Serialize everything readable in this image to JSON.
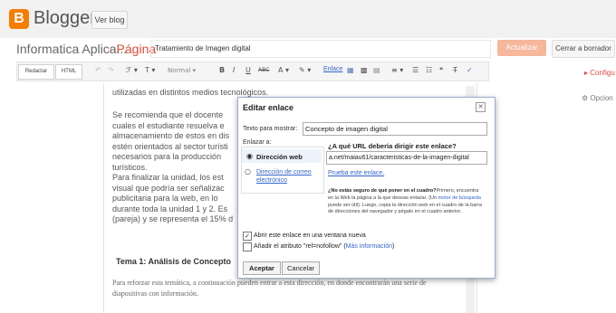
{
  "app": {
    "name": "Blogger",
    "view_blog": "Ver blog",
    "logo_letter": "B"
  },
  "post": {
    "blog_name": "Informatica Aplica...",
    "separator": "· Página",
    "title_value": "Tratamiento de Imagen digital",
    "publish": "Actualizar",
    "close": "Cerrar a borrador"
  },
  "toolbar": {
    "compose": "Redactar",
    "html": "HTML",
    "undo_icon": "↶",
    "redo_icon": "↷",
    "font_icon": "ℱ ▾",
    "size_icon": "T ▾",
    "format": "Normal ▾",
    "bold": "B",
    "italic": "I",
    "underline": "U",
    "strike": "ABC",
    "text_color": "A ▾",
    "highlight": "✎ ▾",
    "link": "Enlace",
    "image_icon": "▦",
    "video_icon": "▩",
    "jump_icon": "▤",
    "align_icon": "≡ ▾",
    "numlist_icon": "☰",
    "bullist_icon": "☷",
    "quote_icon": "❝",
    "clear_icon": "T̶",
    "spell_icon": "✓"
  },
  "sidebar": {
    "config": "▸ Configu",
    "options": "⚙ Opcion"
  },
  "editor": {
    "lines": [
      "utilizadas en distintos medios tecnológicos.",
      "",
      "Se recomienda que el docente",
      "cuales el estudiante resuelva e",
      "almacenamiento de estos en dis",
      "estén orientados al sector turísti",
      "necesarios para la producción",
      "turísticos.",
      "Para finalizar la unidad, los est",
      "visual que podría ser señalizac",
      "publicitaria para la web, en lo",
      "durante toda la unidad 1 y 2. Es",
      "(pareja) y se representa el 15% d"
    ],
    "heading": "Tema 1: Análisis de Concepto",
    "serif_text": "Para reforzar esta temática, a continuación pueden entrar a esta dirección, en donde encontrarán una serie de diapositivas con información."
  },
  "dialog": {
    "title": "Editar enlace",
    "close_icon": "✕",
    "text_label": "Texto para mostrar:",
    "text_value": "Concepto de imagen digital",
    "link_to": "Enlazar a:",
    "web_option": "Dirección web",
    "email_option": "Dirección de correo electrónico",
    "radio_on": "◉",
    "radio_off": "○",
    "url_question": "¿A qué URL debería dirigir este enlace?",
    "url_value": "a.net/maiau61/caracteristicas-de-la-imagen-digital",
    "test_link": "Prueba este enlace.",
    "help_bold": "¿No estás seguro de qué poner en el cuadro?",
    "help_1": "Primero, encuentra en la Web la página a la que deseas enlazar. (Un ",
    "help_link": "motor de búsqueda",
    "help_2": " puede ser útil). Luego, copia la dirección web en el cuadro de la barra de direcciones del navegador y pégalo en el cuadro anterior.",
    "new_window": "Abrir este enlace en una ventana nueva",
    "nofollow": "Añadir el atributo \"rel=nofollow\" (",
    "more_info": "Más información",
    "nofollow_end": ")",
    "check_mark": "✓",
    "ok": "Aceptar",
    "cancel": "Cancelar"
  }
}
